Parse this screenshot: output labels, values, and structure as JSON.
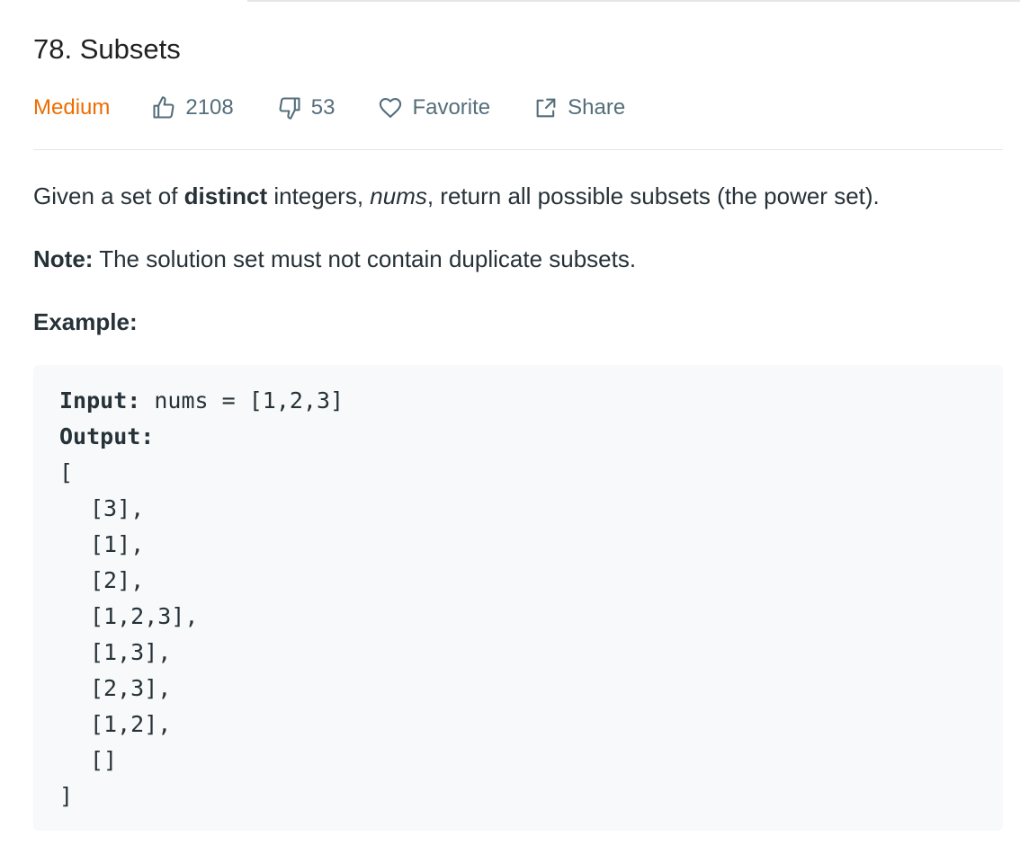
{
  "problem": {
    "title": "78. Subsets",
    "difficulty": "Medium",
    "likes": "2108",
    "dislikes": "53",
    "favorite_label": "Favorite",
    "share_label": "Share"
  },
  "description": {
    "part1": "Given a set of ",
    "bold": "distinct",
    "part2": " integers, ",
    "italic": "nums",
    "part3": ", return all possible subsets (the power set)."
  },
  "note": {
    "label": "Note:",
    "text": " The solution set must not contain duplicate subsets."
  },
  "example": {
    "heading": "Example:",
    "input_label": "Input:",
    "input_value": " nums = [1,2,3]",
    "output_label": "Output:",
    "open_bracket": "[",
    "items": [
      "[3],",
      "[1],",
      "[2],",
      "[1,2,3],",
      "[1,3],",
      "[2,3],",
      "[1,2],",
      "[]"
    ],
    "close_bracket": "]"
  },
  "colors": {
    "difficulty_medium": "#ef6c00",
    "meta_text": "#546e7a",
    "code_bg": "#f7f9fa"
  },
  "icons": [
    "thumbs-up-icon",
    "thumbs-down-icon",
    "heart-icon",
    "share-icon"
  ]
}
